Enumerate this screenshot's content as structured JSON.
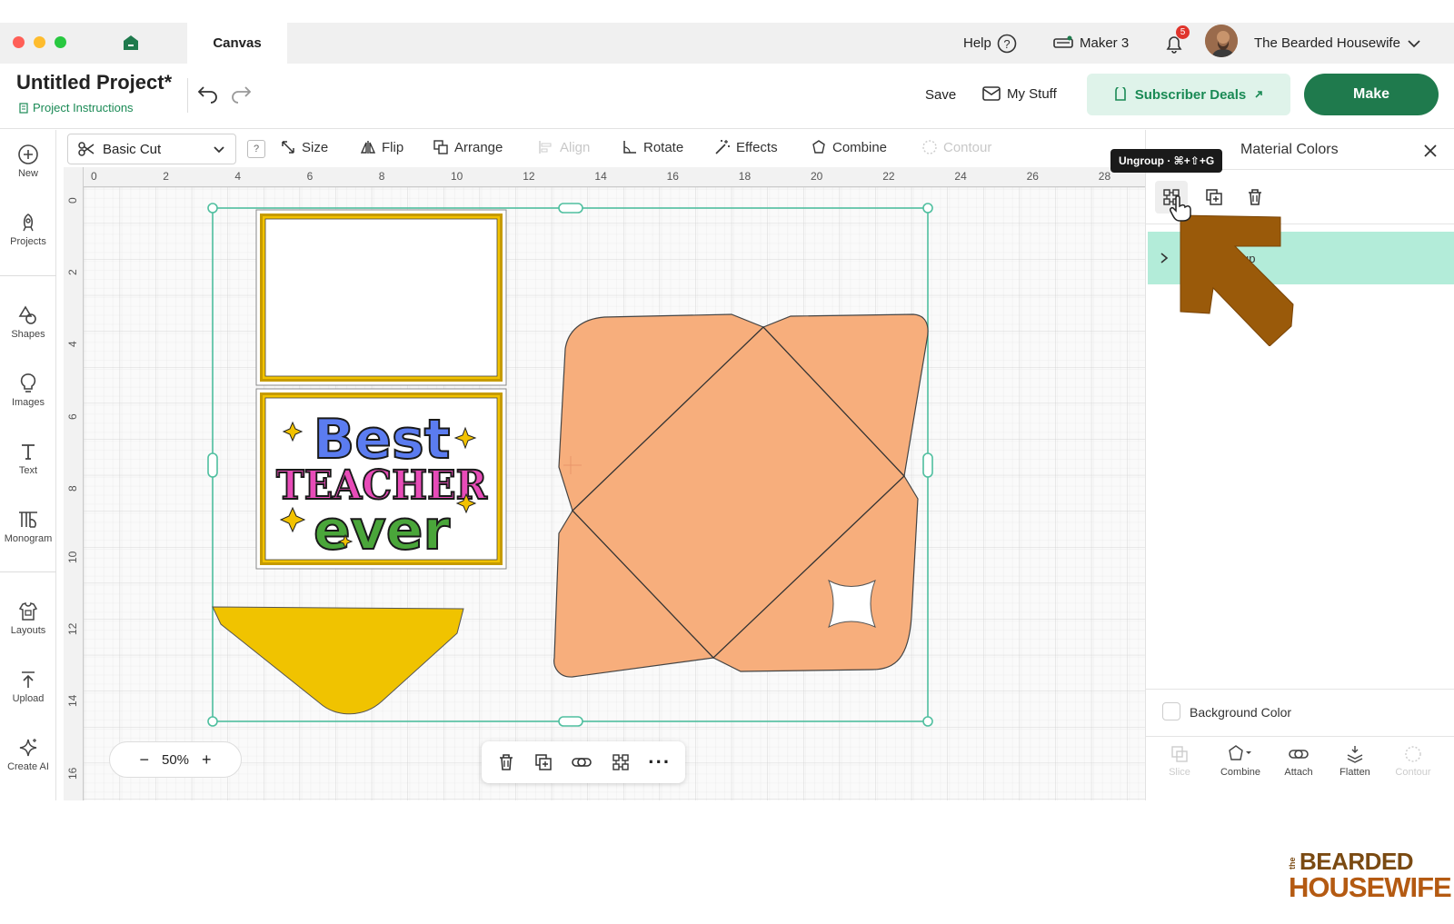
{
  "window": {
    "tab": "Canvas"
  },
  "topbar": {
    "help": "Help",
    "machine": "Maker 3",
    "notifications": "5",
    "user": "The Bearded Housewife"
  },
  "project": {
    "title": "Untitled Project*",
    "instructions": "Project Instructions"
  },
  "actions": {
    "save": "Save",
    "my_stuff": "My Stuff",
    "deals": "Subscriber Deals",
    "make": "Make"
  },
  "toolbar": {
    "operation": "Basic Cut",
    "help": "?",
    "size": "Size",
    "flip": "Flip",
    "arrange": "Arrange",
    "align": "Align",
    "rotate": "Rotate",
    "effects": "Effects",
    "combine": "Combine",
    "contour": "Contour"
  },
  "leftnav": [
    {
      "label": "New",
      "icon": "plus-circle-icon"
    },
    {
      "label": "Projects",
      "icon": "rocket-icon"
    },
    {
      "label": "Shapes",
      "icon": "shapes-icon"
    },
    {
      "label": "Images",
      "icon": "bulb-icon"
    },
    {
      "label": "Text",
      "icon": "text-icon"
    },
    {
      "label": "Monogram",
      "icon": "monogram-icon"
    },
    {
      "label": "Layouts",
      "icon": "layouts-icon"
    },
    {
      "label": "Upload",
      "icon": "upload-icon"
    },
    {
      "label": "Create AI",
      "icon": "sparkle-icon"
    }
  ],
  "ruler": {
    "h": [
      "0",
      "2",
      "4",
      "6",
      "8",
      "10",
      "12",
      "14",
      "16",
      "18",
      "20",
      "22",
      "24",
      "26",
      "28"
    ],
    "v": [
      "0",
      "2",
      "4",
      "6",
      "8",
      "10",
      "12",
      "14",
      "16"
    ]
  },
  "design": {
    "line1": "Best",
    "line2": "TEACHER",
    "line3": "ever"
  },
  "zoom": "50%",
  "panel": {
    "tab": "Material Colors",
    "tooltip": "Ungroup · ⌘+⇧+G",
    "layer_label": "up",
    "background_color": "Background Color",
    "bottom": {
      "slice": "Slice",
      "combine": "Combine",
      "attach": "Attach",
      "flatten": "Flatten",
      "contour": "Contour"
    }
  },
  "watermark": {
    "small": "the",
    "line1": "BEARDED",
    "line2": "HOUSEWIFE"
  }
}
